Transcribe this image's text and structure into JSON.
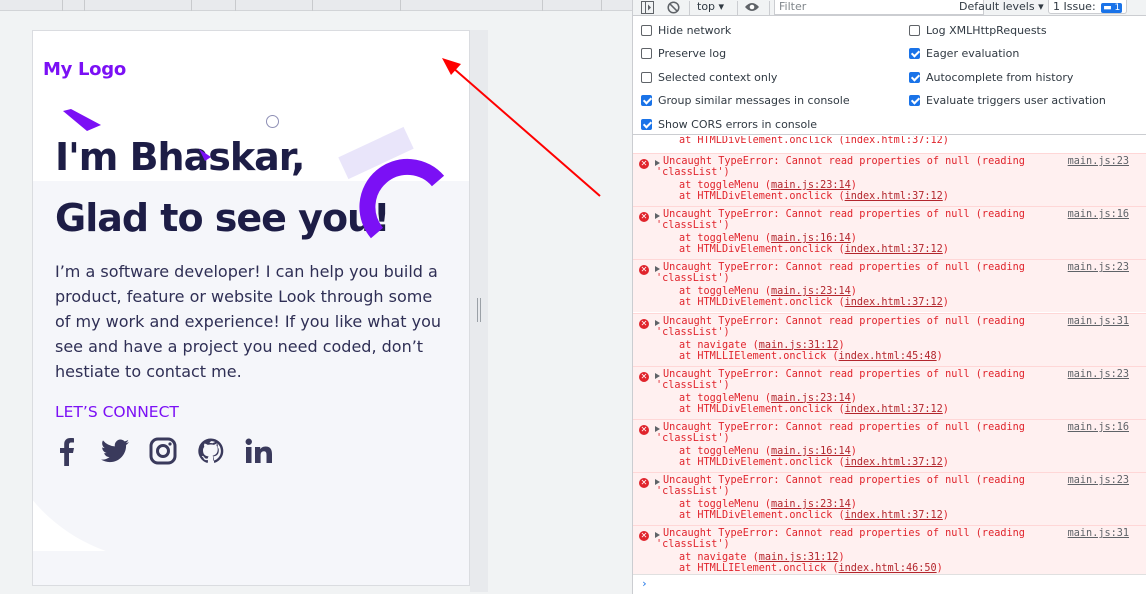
{
  "site": {
    "logo": "My Logo",
    "hero_line1": "I'm Bhaskar,",
    "hero_line2": "Glad to see you!",
    "intro": "I’m a software developer! I can help you build a product, feature or website Look through some of my work and experience! If you like what you see and have a project you need coded, don’t hestiate to contact me.",
    "connect": "LET’S CONNECT",
    "social": [
      "facebook-icon",
      "twitter-icon",
      "instagram-icon",
      "github-icon",
      "linkedin-icon"
    ],
    "colors": {
      "brand": "#7b10f5",
      "heading": "#1d1d46",
      "body": "#2f2f55"
    }
  },
  "annotation": {
    "color": "#ff0000"
  },
  "devtools": {
    "context": "top",
    "filter_placeholder": "Filter",
    "levels": "Default levels",
    "issues_label": "1 Issue:",
    "issues_count": "1",
    "settings_left": [
      {
        "label": "Hide network",
        "checked": false
      },
      {
        "label": "Preserve log",
        "checked": false
      },
      {
        "label": "Selected context only",
        "checked": false
      },
      {
        "label": "Group similar messages in console",
        "checked": true
      },
      {
        "label": "Show CORS errors in console",
        "checked": true
      }
    ],
    "settings_right": [
      {
        "label": "Log XMLHttpRequests",
        "checked": false
      },
      {
        "label": "Eager evaluation",
        "checked": true
      },
      {
        "label": "Autocomplete from history",
        "checked": true
      },
      {
        "label": "Evaluate triggers user activation",
        "checked": true
      }
    ],
    "partial_top": "at HTMLDivElement.onclick (index.html:37:12)",
    "error_line1": "Uncaught TypeError: Cannot read properties of null (reading",
    "error_line2": "'classList')",
    "messages": [
      {
        "source": "main.js:23",
        "fn": "toggleMenu",
        "fn_loc": "main.js:23:14",
        "el": "HTMLDivElement",
        "el_loc": "index.html:37:12"
      },
      {
        "source": "main.js:16",
        "fn": "toggleMenu",
        "fn_loc": "main.js:16:14",
        "el": "HTMLDivElement",
        "el_loc": "index.html:37:12"
      },
      {
        "source": "main.js:23",
        "fn": "toggleMenu",
        "fn_loc": "main.js:23:14",
        "el": "HTMLDivElement",
        "el_loc": "index.html:37:12"
      },
      {
        "source": "main.js:31",
        "fn": "navigate",
        "fn_loc": "main.js:31:12",
        "el": "HTMLLIElement",
        "el_loc": "index.html:45:48"
      },
      {
        "source": "main.js:23",
        "fn": "toggleMenu",
        "fn_loc": "main.js:23:14",
        "el": "HTMLDivElement",
        "el_loc": "index.html:37:12"
      },
      {
        "source": "main.js:16",
        "fn": "toggleMenu",
        "fn_loc": "main.js:16:14",
        "el": "HTMLDivElement",
        "el_loc": "index.html:37:12"
      },
      {
        "source": "main.js:23",
        "fn": "toggleMenu",
        "fn_loc": "main.js:23:14",
        "el": "HTMLDivElement",
        "el_loc": "index.html:37:12"
      },
      {
        "source": "main.js:31",
        "fn": "navigate",
        "fn_loc": "main.js:31:12",
        "el": "HTMLLIElement",
        "el_loc": "index.html:46:50"
      }
    ]
  }
}
